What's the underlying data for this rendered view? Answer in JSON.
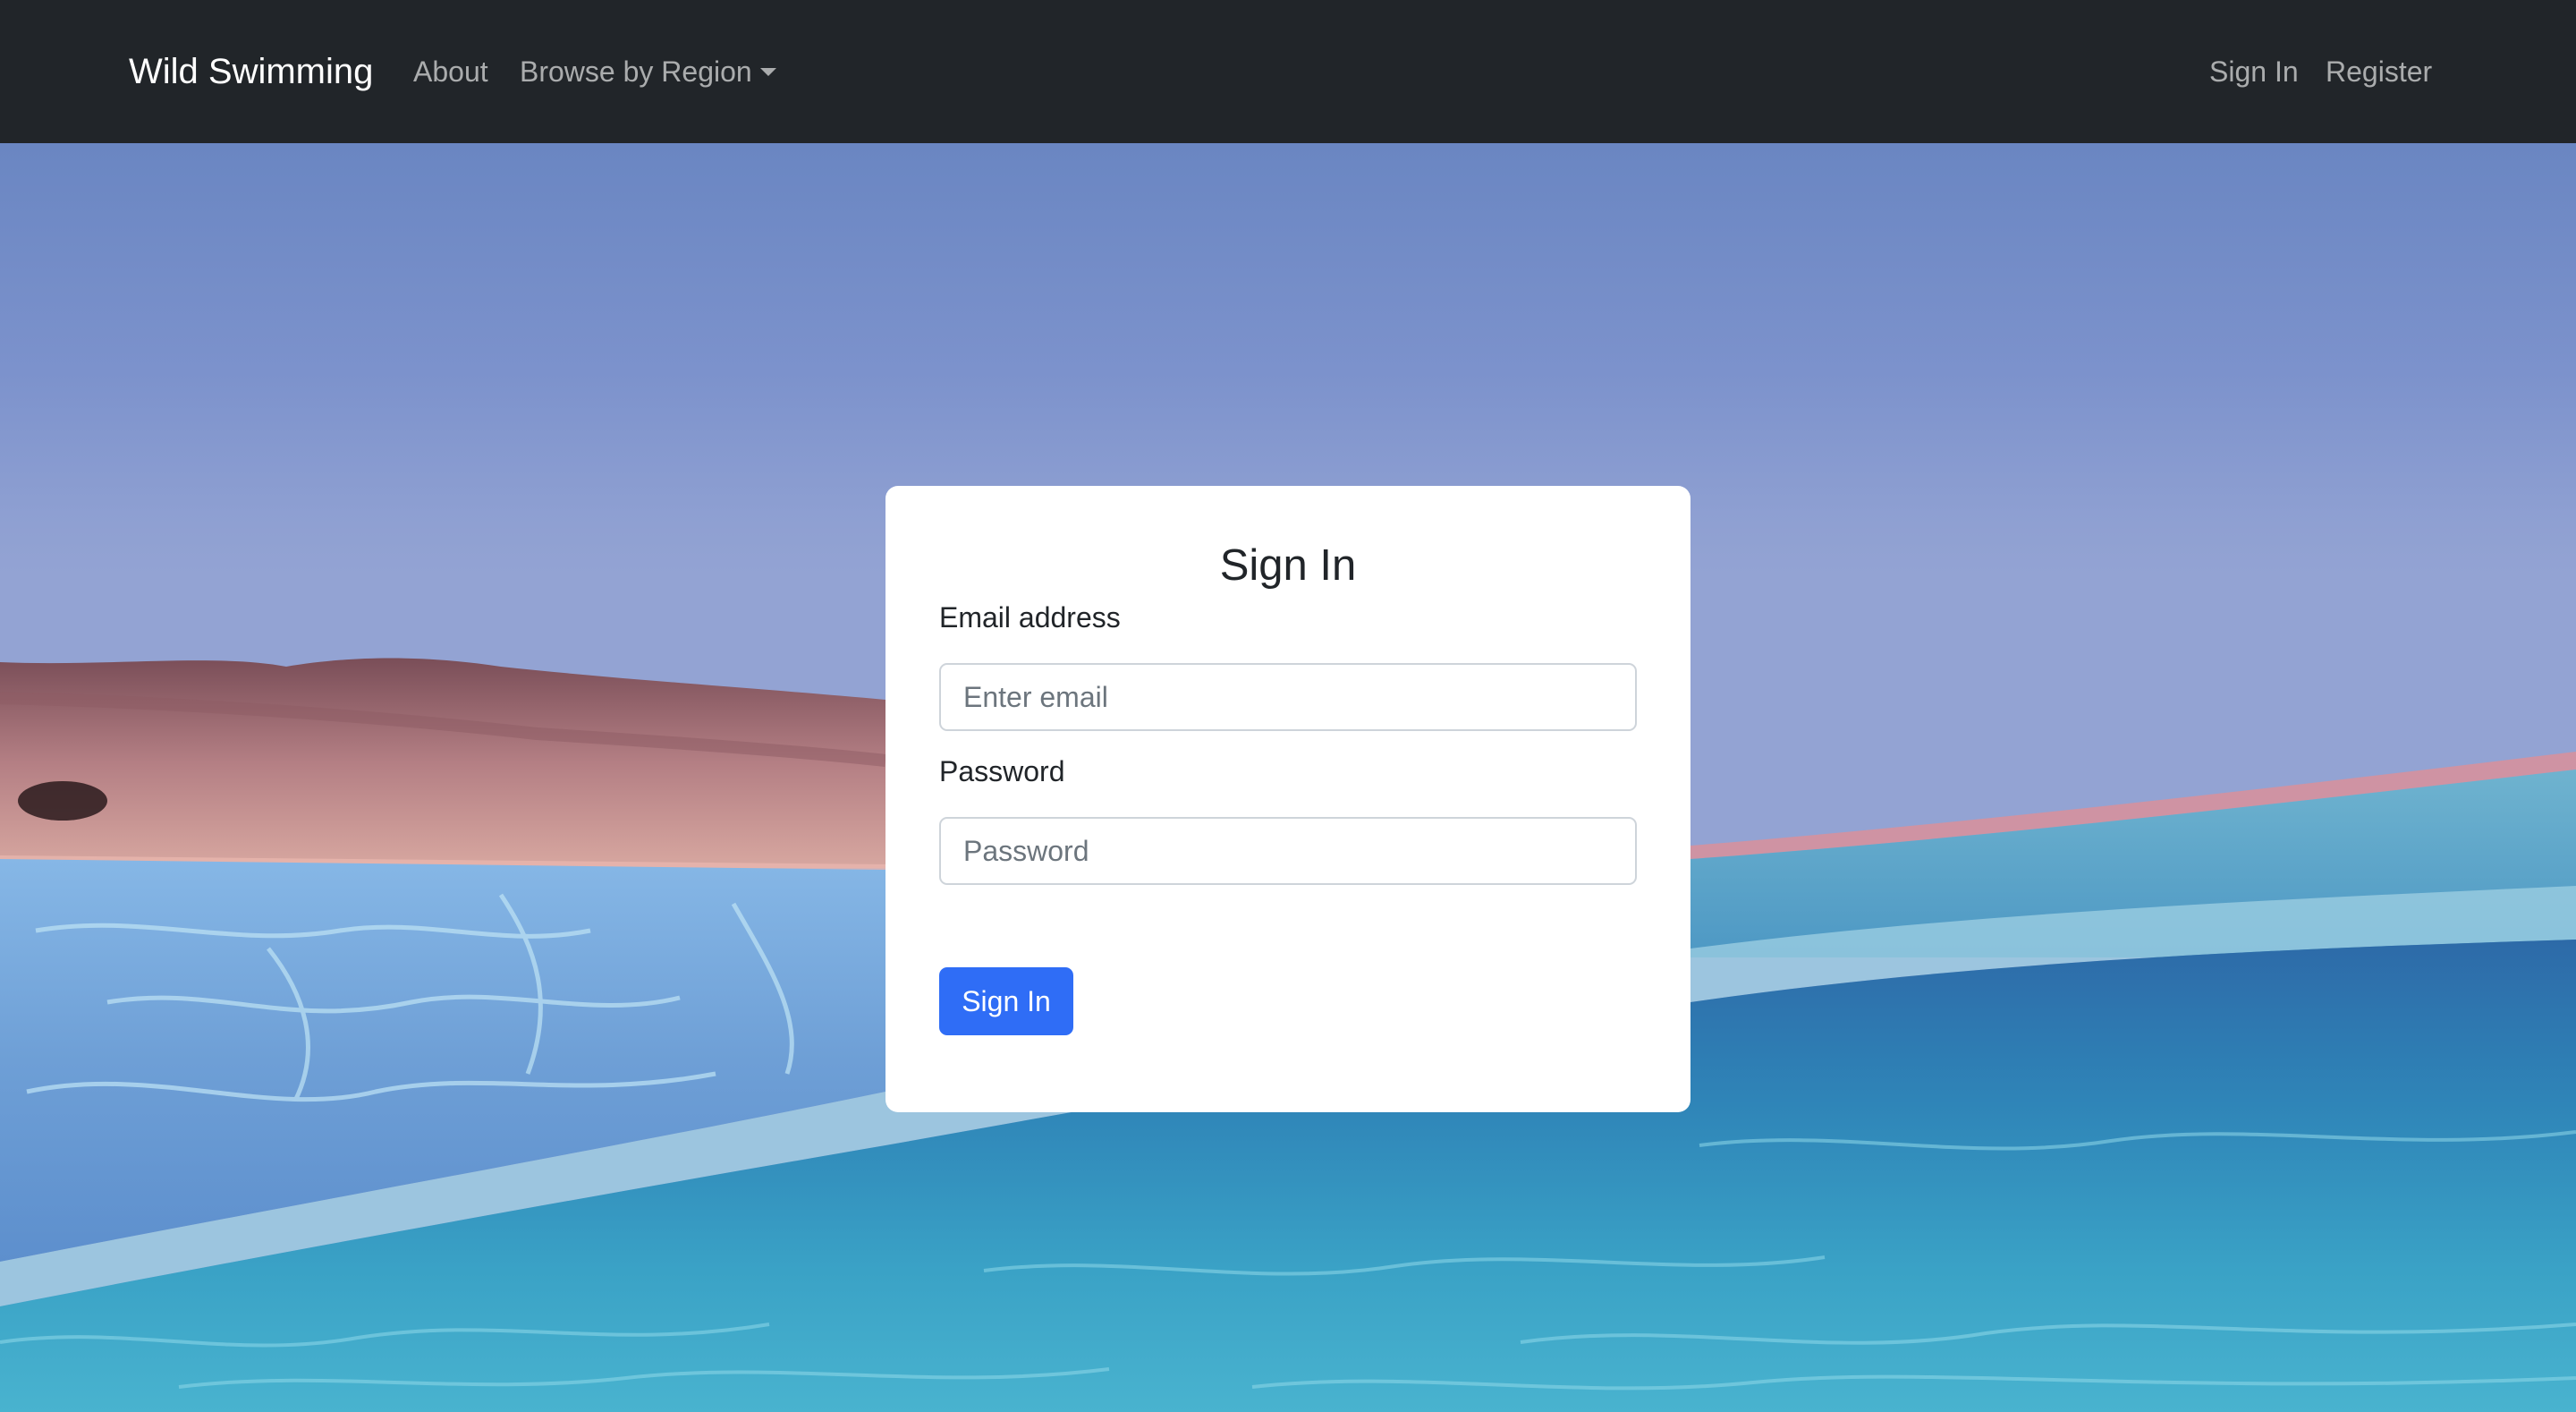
{
  "navbar": {
    "brand": "Wild Swimming",
    "links": {
      "about": "About",
      "browse_by_region": "Browse by Region",
      "sign_in": "Sign In",
      "register": "Register"
    },
    "background_color": "#212529"
  },
  "signin_form": {
    "title": "Sign In",
    "email": {
      "label": "Email address",
      "placeholder": "Enter email",
      "value": ""
    },
    "password": {
      "label": "Password",
      "placeholder": "Password",
      "value": ""
    },
    "submit_label": "Sign In",
    "submit_color": "#2f6df6"
  },
  "background": {
    "icon": "sea-coast-photo"
  }
}
